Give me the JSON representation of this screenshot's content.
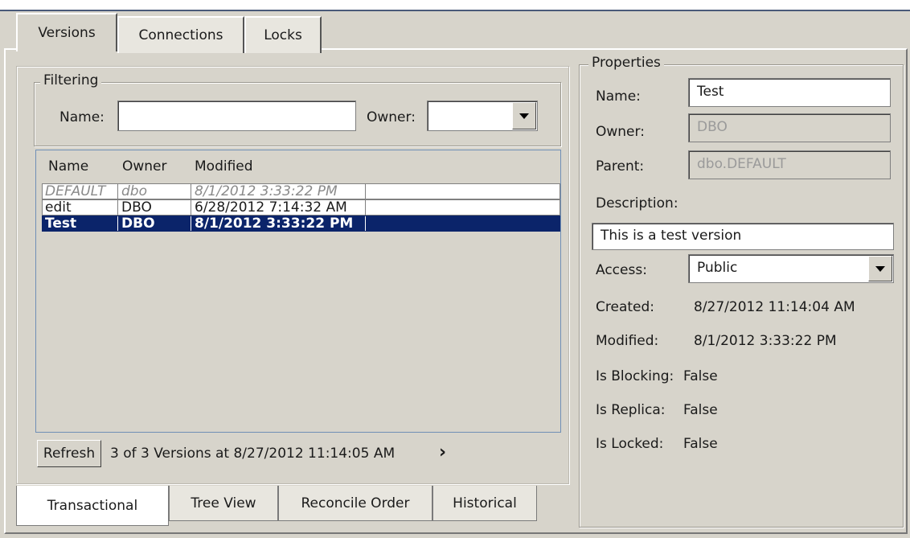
{
  "tabs": {
    "versions": "Versions",
    "connections": "Connections",
    "locks": "Locks"
  },
  "filtering": {
    "legend": "Filtering",
    "name_label": "Name:",
    "name_value": "",
    "owner_label": "Owner:",
    "owner_value": ""
  },
  "table": {
    "headers": {
      "name": "Name",
      "owner": "Owner",
      "modified": "Modified"
    },
    "rows": [
      {
        "name": "DEFAULT",
        "owner": "dbo",
        "modified": "8/1/2012 3:33:22 PM"
      },
      {
        "name": "edit",
        "owner": "DBO",
        "modified": "6/28/2012 7:14:32 AM"
      },
      {
        "name": "Test",
        "owner": "DBO",
        "modified": "8/1/2012 3:33:22 PM"
      }
    ]
  },
  "footer": {
    "refresh_label": "Refresh",
    "status": "3 of 3 Versions at 8/27/2012 11:14:05 AM",
    "next_glyph": "›"
  },
  "bottom_tabs": [
    "Transactional",
    "Tree View",
    "Reconcile Order",
    "Historical"
  ],
  "properties": {
    "legend": "Properties",
    "name_label": "Name:",
    "name_value": "Test",
    "owner_label": "Owner:",
    "owner_value": "DBO",
    "parent_label": "Parent:",
    "parent_value": "dbo.DEFAULT",
    "description_label": "Description:",
    "description_value": "This is a test version",
    "access_label": "Access:",
    "access_value": "Public",
    "created_label": "Created:",
    "created_value": "8/27/2012 11:14:04 AM",
    "modified_label": "Modified:",
    "modified_value": "8/1/2012 3:33:22 PM",
    "is_blocking_label": "Is Blocking:",
    "is_blocking_value": "False",
    "is_replica_label": "Is Replica:",
    "is_replica_value": "False",
    "is_locked_label": "Is Locked:",
    "is_locked_value": "False"
  },
  "colors": {
    "selection": "#0b246a",
    "panel": "#d7d4cb",
    "window_border": "#4a5a79"
  }
}
